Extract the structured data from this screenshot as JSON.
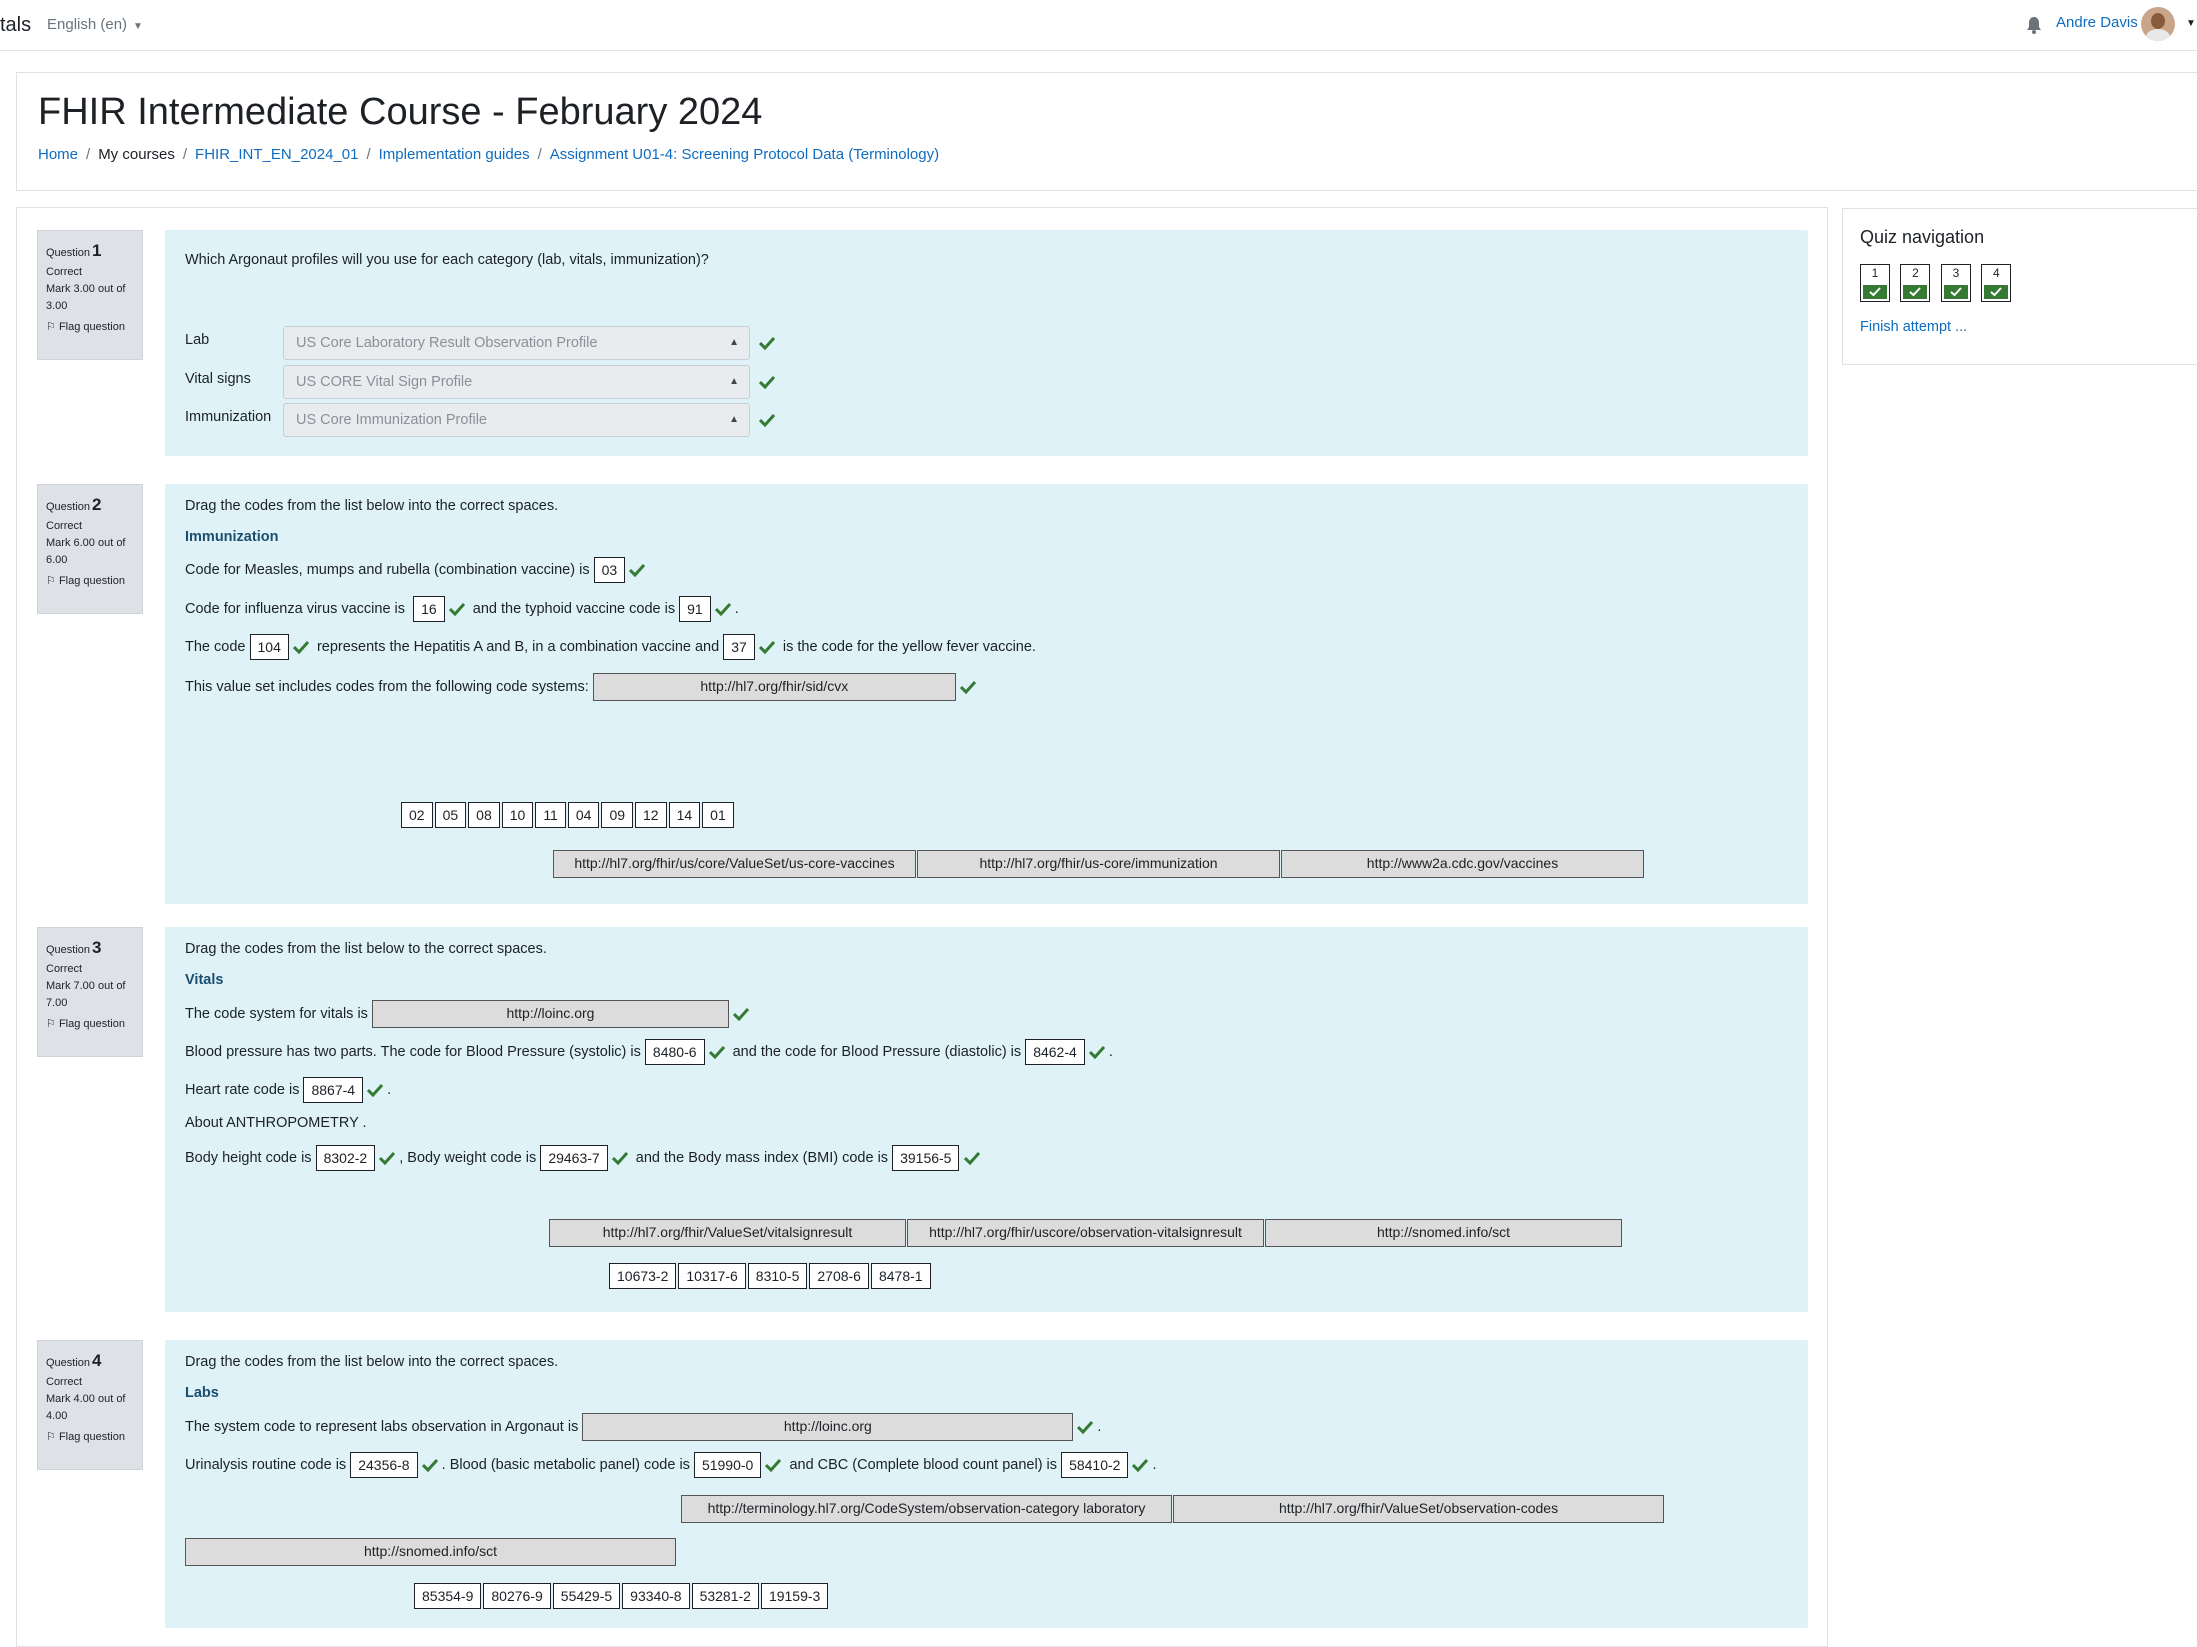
{
  "navbar": {
    "site_name": "tals",
    "language": "English (en)",
    "user_name": "Andre Davis"
  },
  "header": {
    "title": "FHIR Intermediate Course - February 2024",
    "breadcrumb": [
      "Home",
      "My courses",
      "FHIR_INT_EN_2024_01",
      "Implementation guides",
      "Assignment U01-4: Screening Protocol Data (Terminology)"
    ]
  },
  "common": {
    "question_word": "Question",
    "state": "Correct",
    "flag_label": "Flag question"
  },
  "q1": {
    "number": "1",
    "mark": "Mark 3.00 out of 3.00",
    "text": "Which Argonaut profiles will you use for each category (lab, vitals, immunization)?",
    "rows": [
      {
        "label": "Lab",
        "value": "US Core Laboratory Result Observation Profile"
      },
      {
        "label": "Vital signs",
        "value": "US CORE Vital Sign Profile"
      },
      {
        "label": "Immunization",
        "value": "US Core Immunization Profile"
      }
    ]
  },
  "q2": {
    "number": "2",
    "mark": "Mark 6.00 out of 6.00",
    "intro": "Drag the codes from the list below into the correct spaces.",
    "heading": "Immunization",
    "l1_a": "Code for Measles, mumps and rubella (combination vaccine) is",
    "l1_v1": "03",
    "l2_a": "Code for influenza virus vaccine is",
    "l2_v1": "16",
    "l2_b": "and the typhoid vaccine code is",
    "l2_v2": "91",
    "l2_c": ".",
    "l3_a": "The code",
    "l3_v1": "104",
    "l3_b": "represents the Hepatitis A and B, in a combination vaccine and",
    "l3_v2": "37",
    "l3_c": "is the code for the yellow fever vaccine.",
    "l4_a": "This value set includes codes from the following code systems:",
    "l4_v1": "http://hl7.org/fhir/sid/cvx",
    "choices_codes": [
      "02",
      "05",
      "08",
      "10",
      "11",
      "04",
      "09",
      "12",
      "14",
      "01"
    ],
    "choices_urls": [
      "http://hl7.org/fhir/us/core/ValueSet/us-core-vaccines",
      "http://hl7.org/fhir/us-core/immunization",
      "http://www2a.cdc.gov/vaccines"
    ]
  },
  "q3": {
    "number": "3",
    "mark": "Mark 7.00 out of 7.00",
    "intro": "Drag the codes from the list below to the correct spaces.",
    "heading": "Vitals",
    "l1_a": "The code system for vitals is",
    "l1_v1": "http://loinc.org",
    "l2_a": "Blood pressure has two parts. The code for Blood Pressure (systolic) is",
    "l2_v1": "8480-6",
    "l2_b": "and the code for Blood Pressure (diastolic) is",
    "l2_v2": "8462-4",
    "l2_c": ".",
    "l3_a": "Heart rate code is",
    "l3_v1": "8867-4",
    "l3_c": ".",
    "l4_a": "About ANTHROPOMETRY .",
    "l5_a": "Body height code is",
    "l5_v1": "8302-2",
    "l5_b": ",  Body weight code is",
    "l5_v2": "29463-7",
    "l5_c": "and the Body mass index (BMI) code is",
    "l5_v3": "39156-5",
    "choices_urls": [
      "http://hl7.org/fhir/ValueSet/vitalsignresult",
      "http://hl7.org/fhir/uscore/observation-vitalsignresult",
      "http://snomed.info/sct"
    ],
    "choices_codes": [
      "10673-2",
      "10317-6",
      "8310-5",
      "2708-6",
      "8478-1"
    ]
  },
  "q4": {
    "number": "4",
    "mark": "Mark 4.00 out of 4.00",
    "intro": "Drag the codes from the list below into the correct spaces.",
    "heading": "Labs",
    "l1_a": "The system code to represent labs observation in Argonaut is",
    "l1_v1": "http://loinc.org",
    "l1_c": ".",
    "l2_a": "Urinalysis routine code is",
    "l2_v1": "24356-8",
    "l2_b": ". Blood (basic metabolic panel) code is",
    "l2_v2": "51990-0",
    "l2_c": "and CBC (Complete blood count panel) is",
    "l2_v3": "58410-2",
    "l2_d": ".",
    "choices_urls": [
      "http://terminology.hl7.org/CodeSystem/observation-category laboratory",
      "http://hl7.org/fhir/ValueSet/observation-codes"
    ],
    "choices_urls2": [
      "http://snomed.info/sct"
    ],
    "choices_codes": [
      "85354-9",
      "80276-9",
      "55429-5",
      "93340-8",
      "53281-2",
      "19159-3"
    ]
  },
  "quiz_nav": {
    "title": "Quiz navigation",
    "buttons": [
      "1",
      "2",
      "3",
      "4"
    ],
    "finish": "Finish attempt ..."
  },
  "colors": {
    "link": "#0f6cbf",
    "question_bg": "#def2f8",
    "correct_green": "#357a32"
  }
}
